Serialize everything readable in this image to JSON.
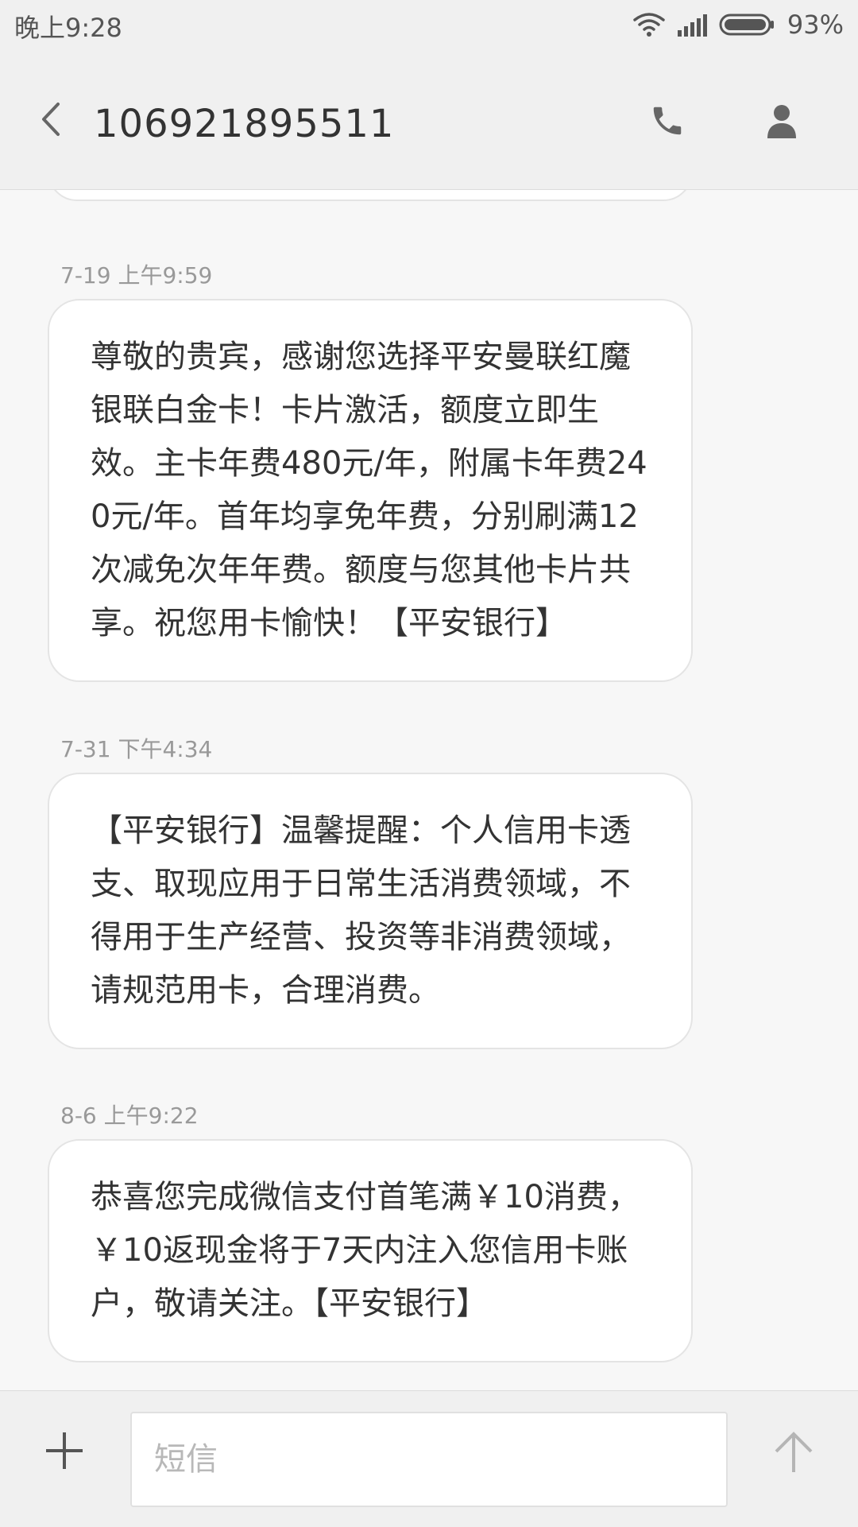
{
  "status_bar": {
    "time": "晚上9:28",
    "battery": "93%",
    "icons": [
      "wifi-icon",
      "signal-icon",
      "battery-icon"
    ]
  },
  "header": {
    "title": "106921895511",
    "icons": [
      "back-icon",
      "phone-icon",
      "contact-icon"
    ]
  },
  "messages": [
    {
      "timestamp": "7-19 上午9:59",
      "text": "尊敬的贵宾，感谢您选择平安曼联红魔银联白金卡！卡片激活，额度立即生效。主卡年费480元/年，附属卡年费240元/年。首年均享免年费，分别刷满12次减免次年年费。额度与您其他卡片共享。祝您用卡愉快！【平安银行】"
    },
    {
      "timestamp": "7-31 下午4:34",
      "text": "【平安银行】温馨提醒：个人信用卡透支、取现应用于日常生活消费领域，不得用于生产经营、投资等非消费领域，请规范用卡，合理消费。"
    },
    {
      "timestamp": "8-6 上午9:22",
      "text": "恭喜您完成微信支付首笔满￥10消费，￥10返现金将于7天内注入您信用卡账户，敬请关注。【平安银行】"
    }
  ],
  "composer": {
    "placeholder": "短信",
    "value": "",
    "icons": [
      "plus-icon",
      "send-arrow-icon"
    ]
  },
  "colors": {
    "background": "#f7f7f7",
    "bar": "#f0f0f0",
    "bubble": "#ffffff",
    "text": "#333333",
    "timestamp": "#999999",
    "icon": "#666666"
  }
}
